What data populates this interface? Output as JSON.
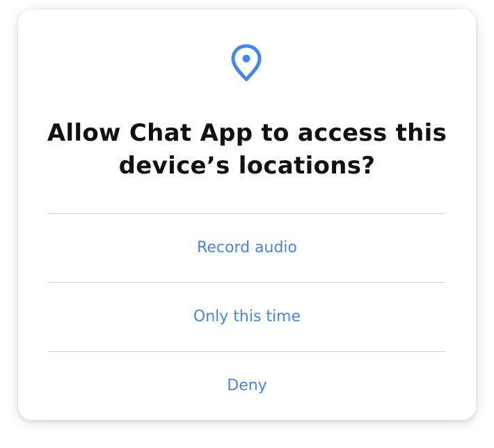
{
  "dialog": {
    "icon": "location-pin-icon",
    "title": "Allow Chat App to access this device’s locations?",
    "options": [
      {
        "label": "Record audio"
      },
      {
        "label": "Only this time"
      },
      {
        "label": "Deny"
      }
    ]
  },
  "colors": {
    "accent": "#4285f4",
    "title_text": "#111111",
    "divider": "#cfcfcf",
    "background": "#ffffff"
  }
}
